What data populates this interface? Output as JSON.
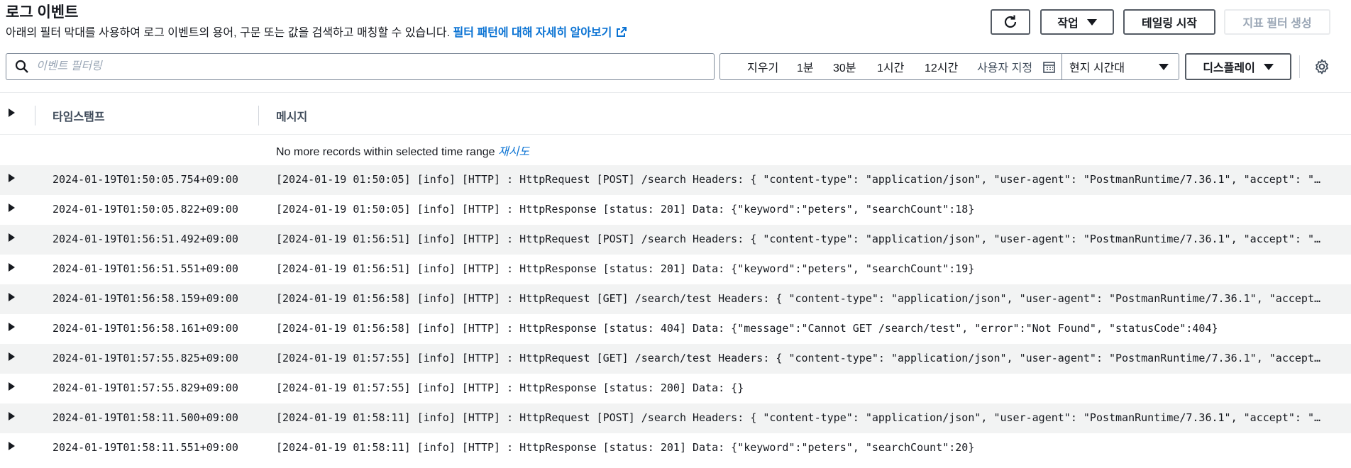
{
  "header": {
    "title": "로그 이벤트",
    "description": "아래의 필터 막대를 사용하여 로그 이벤트의 용어, 구문 또는 값을 검색하고 매칭할 수 있습니다.",
    "learn_more_link": "필터 패턴에 대해 자세히 알아보기",
    "external_icon": "external-link-icon"
  },
  "toolbar": {
    "refresh_icon": "refresh-icon",
    "actions_label": "작업",
    "tailing_label": "테일링 시작",
    "metric_filter_label": "지표 필터 생성"
  },
  "search": {
    "icon": "search-icon",
    "placeholder": "이벤트 필터링",
    "value": ""
  },
  "time_range": {
    "clear": "지우기",
    "options": [
      "1분",
      "30분",
      "1시간",
      "12시간"
    ],
    "custom": "사용자 지정",
    "calendar_icon": "calendar-icon",
    "timezone": "현지 시간대",
    "display_label": "디스플레이",
    "settings_icon": "gear-icon"
  },
  "table": {
    "columns": [
      "타임스탬프",
      "메시지"
    ],
    "no_more_records": "No more records within selected time range",
    "retry": "재시도",
    "rows": [
      {
        "timestamp": "2024-01-19T01:50:05.754+09:00",
        "message": "[2024-01-19 01:50:05] [info] [HTTP] : HttpRequest [POST] /search Headers: { \"content-type\": \"application/json\", \"user-agent\": \"PostmanRuntime/7.36.1\", \"accept\": \"*/*\", \"postman-token\": \"…\""
      },
      {
        "timestamp": "2024-01-19T01:50:05.822+09:00",
        "message": "[2024-01-19 01:50:05] [info] [HTTP] : HttpResponse [status: 201] Data: {\"keyword\":\"peters\", \"searchCount\":18}"
      },
      {
        "timestamp": "2024-01-19T01:56:51.492+09:00",
        "message": "[2024-01-19 01:56:51] [info] [HTTP] : HttpRequest [POST] /search Headers: { \"content-type\": \"application/json\", \"user-agent\": \"PostmanRuntime/7.36.1\", \"accept\": \"*/*\", \"postman-token\": \"…\""
      },
      {
        "timestamp": "2024-01-19T01:56:51.551+09:00",
        "message": "[2024-01-19 01:56:51] [info] [HTTP] : HttpResponse [status: 201] Data: {\"keyword\":\"peters\", \"searchCount\":19}"
      },
      {
        "timestamp": "2024-01-19T01:56:58.159+09:00",
        "message": "[2024-01-19 01:56:58] [info] [HTTP] : HttpRequest [GET] /search/test Headers: { \"content-type\": \"application/json\", \"user-agent\": \"PostmanRuntime/7.36.1\", \"accept\": \"*/*\", \"postman-token\": \"…\""
      },
      {
        "timestamp": "2024-01-19T01:56:58.161+09:00",
        "message": "[2024-01-19 01:56:58] [info] [HTTP] : HttpResponse [status: 404] Data: {\"message\":\"Cannot GET /search/test\", \"error\":\"Not Found\", \"statusCode\":404}"
      },
      {
        "timestamp": "2024-01-19T01:57:55.825+09:00",
        "message": "[2024-01-19 01:57:55] [info] [HTTP] : HttpRequest [GET] /search/test Headers: { \"content-type\": \"application/json\", \"user-agent\": \"PostmanRuntime/7.36.1\", \"accept\": \"*/*\", \"postman-token\": \"…\""
      },
      {
        "timestamp": "2024-01-19T01:57:55.829+09:00",
        "message": "[2024-01-19 01:57:55] [info] [HTTP] : HttpResponse [status: 200] Data: {}"
      },
      {
        "timestamp": "2024-01-19T01:58:11.500+09:00",
        "message": "[2024-01-19 01:58:11] [info] [HTTP] : HttpRequest [POST] /search Headers: { \"content-type\": \"application/json\", \"user-agent\": \"PostmanRuntime/7.36.1\", \"accept\": \"*/*\", \"postman-token\": \"…\""
      },
      {
        "timestamp": "2024-01-19T01:58:11.551+09:00",
        "message": "[2024-01-19 01:58:11] [info] [HTTP] : HttpResponse [status: 201] Data: {\"keyword\":\"peters\", \"searchCount\":20}"
      }
    ]
  }
}
